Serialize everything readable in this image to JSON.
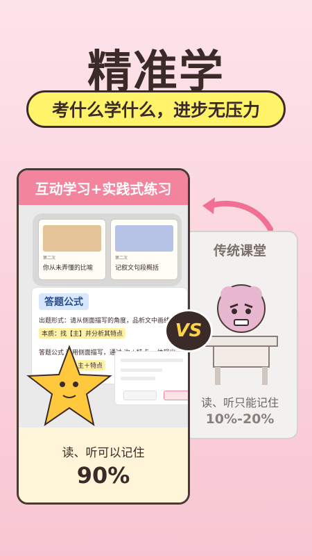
{
  "header": {
    "title": "精准学"
  },
  "subtitle": "考什么学什么，进步无压力",
  "left_card": {
    "header": "互动学习+实践式练习",
    "lessons": [
      {
        "kicker": "第二次",
        "label": "你从未弄懂的比喻"
      },
      {
        "kicker": "第二次",
        "label": "记叙文句段概括"
      }
    ],
    "formula": {
      "tag": "答题公式",
      "line1": "出题形式：请从侧面描写的角度，品析文中画线的句子。",
      "line2": "本质：找【主】并分析其特点",
      "line3": "答题公式  运用侧面描写，通过  次＋特点  ，体现出",
      "line4": "主＋特点"
    },
    "caption": "读、听可以记住",
    "stat": "90%"
  },
  "right_card": {
    "title": "传统课堂",
    "caption": "读、听只能记住",
    "stat": "10%-20%"
  },
  "vs_label": "VS",
  "colors": {
    "accent_pink": "#f2849d",
    "pill_yellow": "#fff36a",
    "dark": "#3a2a28"
  }
}
